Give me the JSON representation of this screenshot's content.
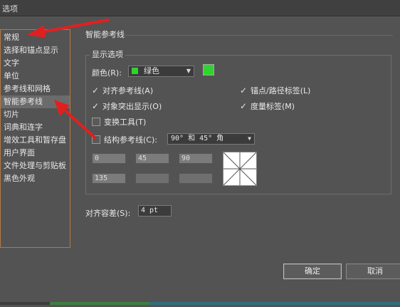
{
  "window": {
    "title": "选项"
  },
  "sidebar": {
    "items": [
      {
        "label": "常规"
      },
      {
        "label": "选择和锚点显示"
      },
      {
        "label": "文字"
      },
      {
        "label": "单位"
      },
      {
        "label": "参考线和网格"
      },
      {
        "label": "智能参考线"
      },
      {
        "label": "切片"
      },
      {
        "label": "词典和连字"
      },
      {
        "label": "增效工具和暂存盘"
      },
      {
        "label": "用户界面"
      },
      {
        "label": "文件处理与剪贴板"
      },
      {
        "label": "黑色外观"
      }
    ],
    "active_index": 5
  },
  "panel": {
    "title": "智能参考线",
    "display_group": {
      "label": "显示选项",
      "color_label": "颜色(R):",
      "color_value": "绿色",
      "color_hex": "#2ed52e",
      "checks": {
        "align_guides": {
          "label": "对齐参考线(A)",
          "checked": true
        },
        "anchor_labels": {
          "label": "锚点/路径标签(L)",
          "checked": true
        },
        "object_highlight": {
          "label": "对象突出显示(O)",
          "checked": true
        },
        "measure_labels": {
          "label": "度量标签(M)",
          "checked": true
        },
        "transform_tools": {
          "label": "变换工具(T)",
          "checked": false
        },
        "construction_guides": {
          "label": "结构参考线(C):",
          "checked": false
        }
      },
      "construction_value": "90° 和 45° 角",
      "angles": [
        "0",
        "45",
        "90",
        "135",
        "",
        ""
      ]
    },
    "snap_tolerance": {
      "label": "对齐容差(S):",
      "value": "4 pt"
    }
  },
  "buttons": {
    "ok": "确定",
    "cancel": "取消"
  },
  "colors": {
    "arrow": "#e02020",
    "background": "#535353"
  }
}
